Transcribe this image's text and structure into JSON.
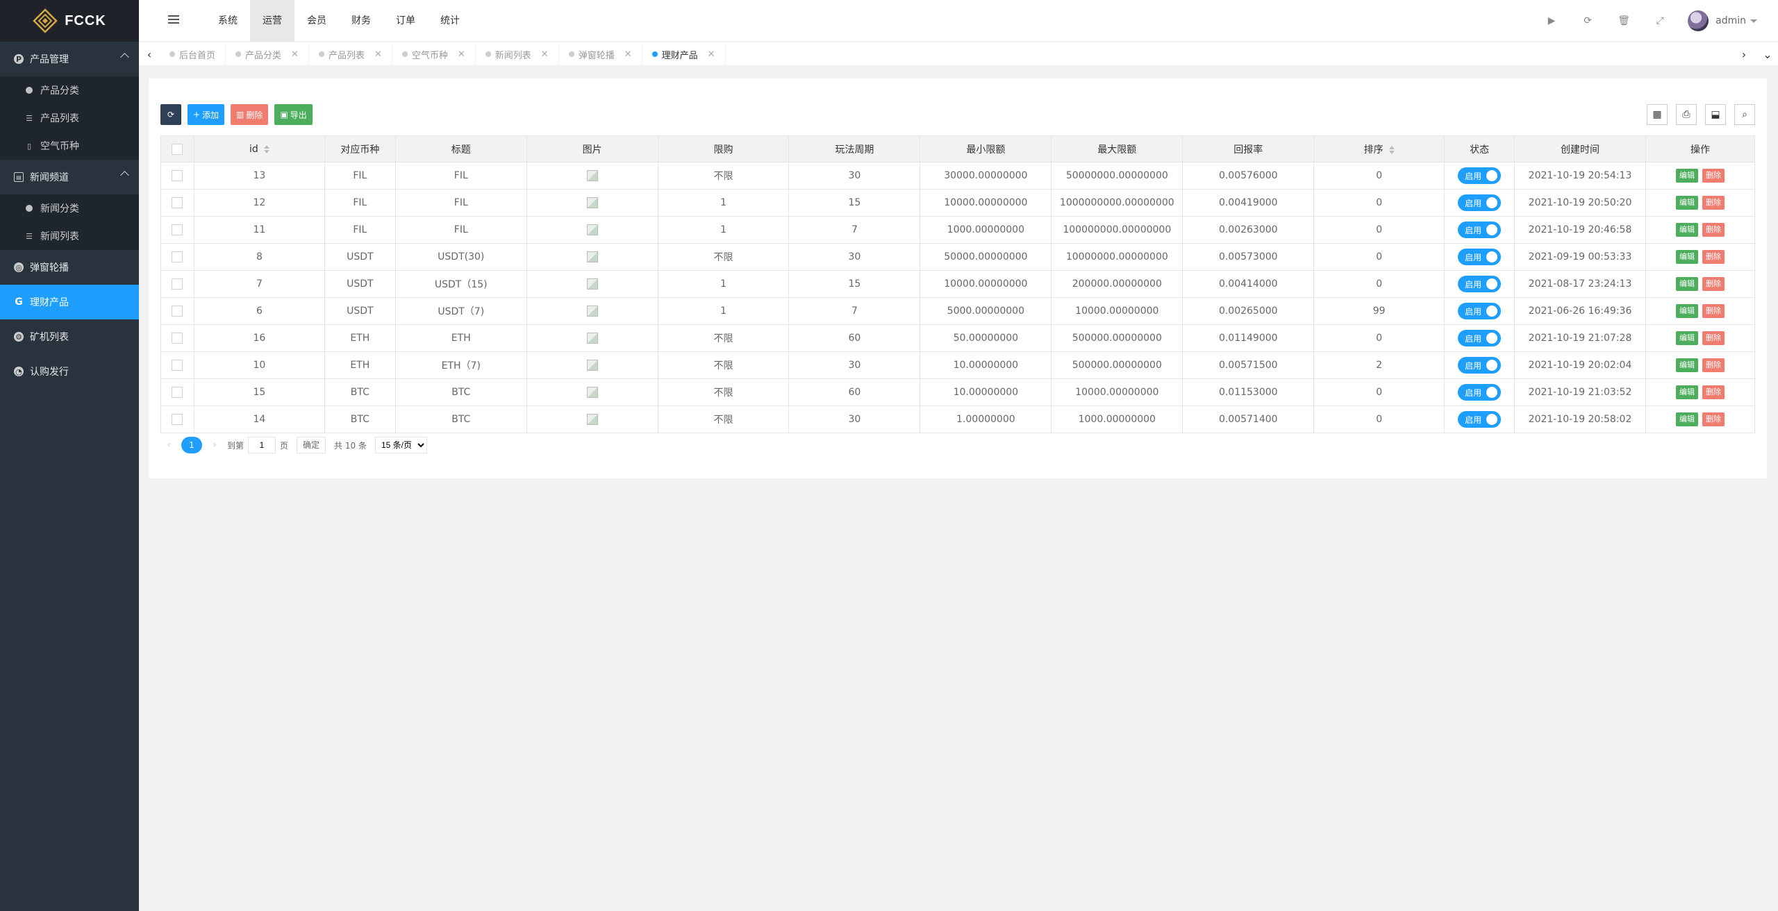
{
  "brand": {
    "name": "FCCK"
  },
  "sidebar": {
    "groups": [
      {
        "label": "产品管理",
        "icon": "product-icon",
        "expanded": true,
        "children": [
          {
            "label": "产品分类",
            "icon": "dot-icon"
          },
          {
            "label": "产品列表",
            "icon": "list-icon"
          },
          {
            "label": "空气币种",
            "icon": "coin-icon"
          }
        ]
      },
      {
        "label": "新闻频道",
        "icon": "news-icon",
        "expanded": true,
        "children": [
          {
            "label": "新闻分类",
            "icon": "dot-icon"
          },
          {
            "label": "新闻列表",
            "icon": "list-icon"
          }
        ]
      },
      {
        "label": "弹窗轮播",
        "icon": "carousel-icon"
      },
      {
        "label": "理财产品",
        "icon": "finance-icon",
        "active": true
      },
      {
        "label": "矿机列表",
        "icon": "miner-icon"
      },
      {
        "label": "认购发行",
        "icon": "subscribe-icon"
      }
    ]
  },
  "header": {
    "menu": [
      "系统",
      "运营",
      "会员",
      "财务",
      "订单",
      "统计"
    ],
    "active_menu": "运营",
    "username": "admin"
  },
  "tabs": [
    {
      "label": "后台首页",
      "closable": false
    },
    {
      "label": "产品分类",
      "closable": true
    },
    {
      "label": "产品列表",
      "closable": true
    },
    {
      "label": "空气币种",
      "closable": true
    },
    {
      "label": "新闻列表",
      "closable": true
    },
    {
      "label": "弹窗轮播",
      "closable": true
    },
    {
      "label": "理财产品",
      "closable": true,
      "active": true
    }
  ],
  "toolbar": {
    "add": "添加",
    "delete": "删除",
    "export": "导出"
  },
  "table": {
    "columns": [
      "id",
      "对应币种",
      "标题",
      "图片",
      "限购",
      "玩法周期",
      "最小限额",
      "最大限额",
      "回报率",
      "排序",
      "状态",
      "创建时间",
      "操作"
    ],
    "status_label": "启用",
    "edit_label": "编辑",
    "delete_label": "删除",
    "rows": [
      {
        "id": "13",
        "coin": "FIL",
        "title": "FIL",
        "limit": "不限",
        "cycle": "30",
        "min": "30000.00000000",
        "max": "50000000.00000000",
        "rate": "0.00576000",
        "sort": "0",
        "created": "2021-10-19 20:54:13"
      },
      {
        "id": "12",
        "coin": "FIL",
        "title": "FIL",
        "limit": "1",
        "cycle": "15",
        "min": "10000.00000000",
        "max": "1000000000.00000000",
        "rate": "0.00419000",
        "sort": "0",
        "created": "2021-10-19 20:50:20"
      },
      {
        "id": "11",
        "coin": "FIL",
        "title": "FIL",
        "limit": "1",
        "cycle": "7",
        "min": "1000.00000000",
        "max": "100000000.00000000",
        "rate": "0.00263000",
        "sort": "0",
        "created": "2021-10-19 20:46:58"
      },
      {
        "id": "8",
        "coin": "USDT",
        "title": "USDT(30)",
        "limit": "不限",
        "cycle": "30",
        "min": "50000.00000000",
        "max": "10000000.00000000",
        "rate": "0.00573000",
        "sort": "0",
        "created": "2021-09-19 00:53:33"
      },
      {
        "id": "7",
        "coin": "USDT",
        "title": "USDT（15)",
        "limit": "1",
        "cycle": "15",
        "min": "10000.00000000",
        "max": "200000.00000000",
        "rate": "0.00414000",
        "sort": "0",
        "created": "2021-08-17 23:24:13"
      },
      {
        "id": "6",
        "coin": "USDT",
        "title": "USDT（7)",
        "limit": "1",
        "cycle": "7",
        "min": "5000.00000000",
        "max": "10000.00000000",
        "rate": "0.00265000",
        "sort": "99",
        "created": "2021-06-26 16:49:36"
      },
      {
        "id": "16",
        "coin": "ETH",
        "title": "ETH",
        "limit": "不限",
        "cycle": "60",
        "min": "50.00000000",
        "max": "500000.00000000",
        "rate": "0.01149000",
        "sort": "0",
        "created": "2021-10-19 21:07:28"
      },
      {
        "id": "10",
        "coin": "ETH",
        "title": "ETH（7)",
        "limit": "不限",
        "cycle": "30",
        "min": "10.00000000",
        "max": "500000.00000000",
        "rate": "0.00571500",
        "sort": "2",
        "created": "2021-10-19 20:02:04"
      },
      {
        "id": "15",
        "coin": "BTC",
        "title": "BTC",
        "limit": "不限",
        "cycle": "60",
        "min": "10.00000000",
        "max": "10000.00000000",
        "rate": "0.01153000",
        "sort": "0",
        "created": "2021-10-19 21:03:52"
      },
      {
        "id": "14",
        "coin": "BTC",
        "title": "BTC",
        "limit": "不限",
        "cycle": "30",
        "min": "1.00000000",
        "max": "1000.00000000",
        "rate": "0.00571400",
        "sort": "0",
        "created": "2021-10-19 20:58:02"
      }
    ]
  },
  "pager": {
    "current": "1",
    "goto_label": "到第",
    "page_value": "1",
    "page_unit": "页",
    "confirm": "确定",
    "total": "共 10 条",
    "page_size": "15 条/页"
  },
  "colors": {
    "accent": "#1e9fff",
    "sidebar": "#28333e",
    "edit": "#4cae5c",
    "delete": "#f07b6f"
  }
}
